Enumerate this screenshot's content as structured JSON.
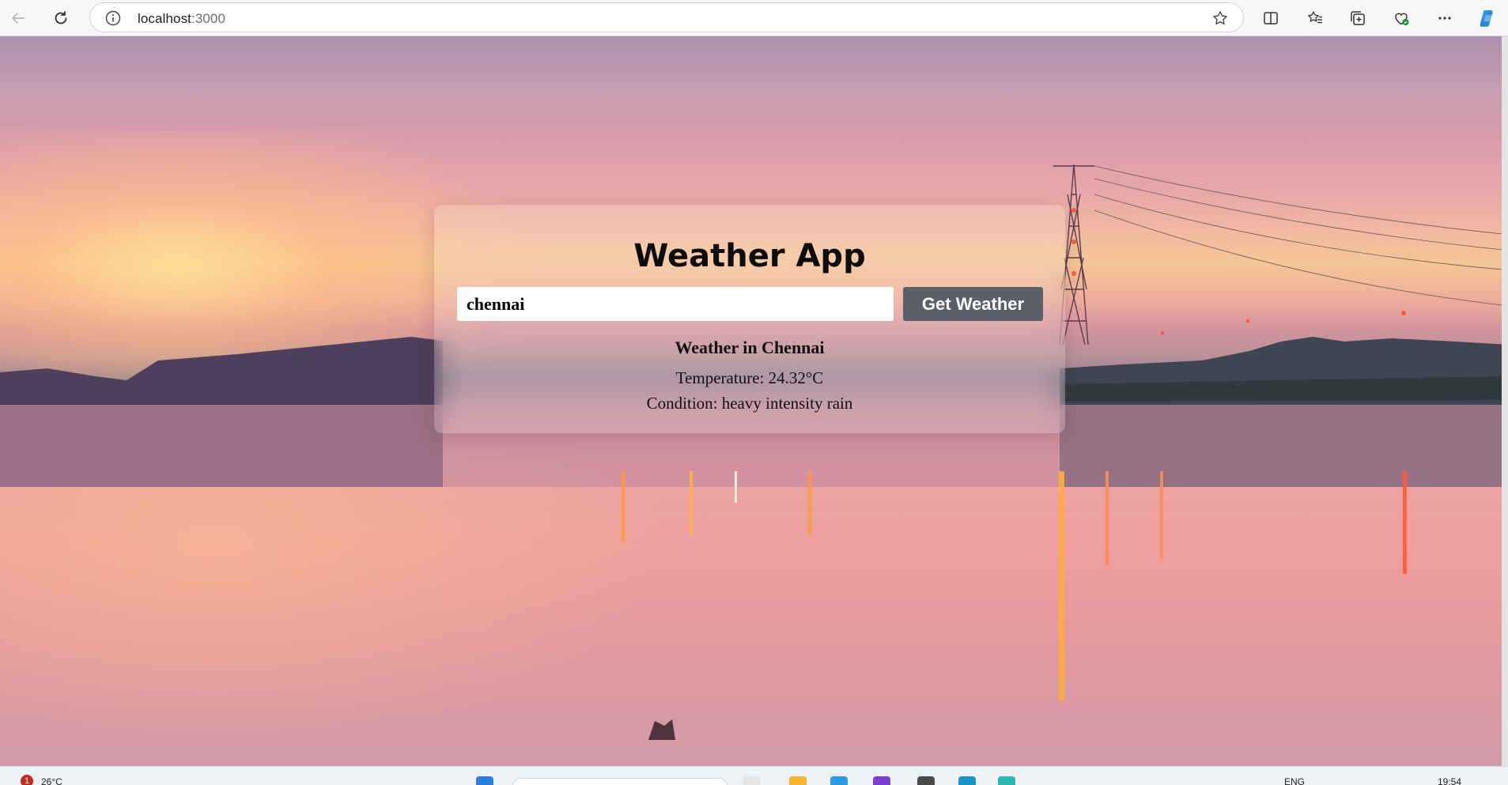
{
  "browser": {
    "url_host": "localhost",
    "url_port": ":3000",
    "icons": [
      "back-arrow-icon",
      "refresh-icon",
      "site-info-icon",
      "star-icon",
      "split-screen-icon",
      "favorites-icon",
      "collections-icon",
      "browser-essentials-icon",
      "more-icon",
      "copilot-icon"
    ]
  },
  "app": {
    "title": "Weather App",
    "search": {
      "value": "chennai",
      "button_label": "Get Weather"
    },
    "result": {
      "heading": "Weather in Chennai",
      "temperature": "Temperature: 24.32°C",
      "condition": "Condition: heavy intensity rain"
    }
  },
  "taskbar": {
    "notification_count": "1",
    "weather": "26°C",
    "language": "ENG",
    "time": "19:54"
  },
  "colors": {
    "button_bg": "#5b6068",
    "title_text": "#0d0d0d"
  }
}
